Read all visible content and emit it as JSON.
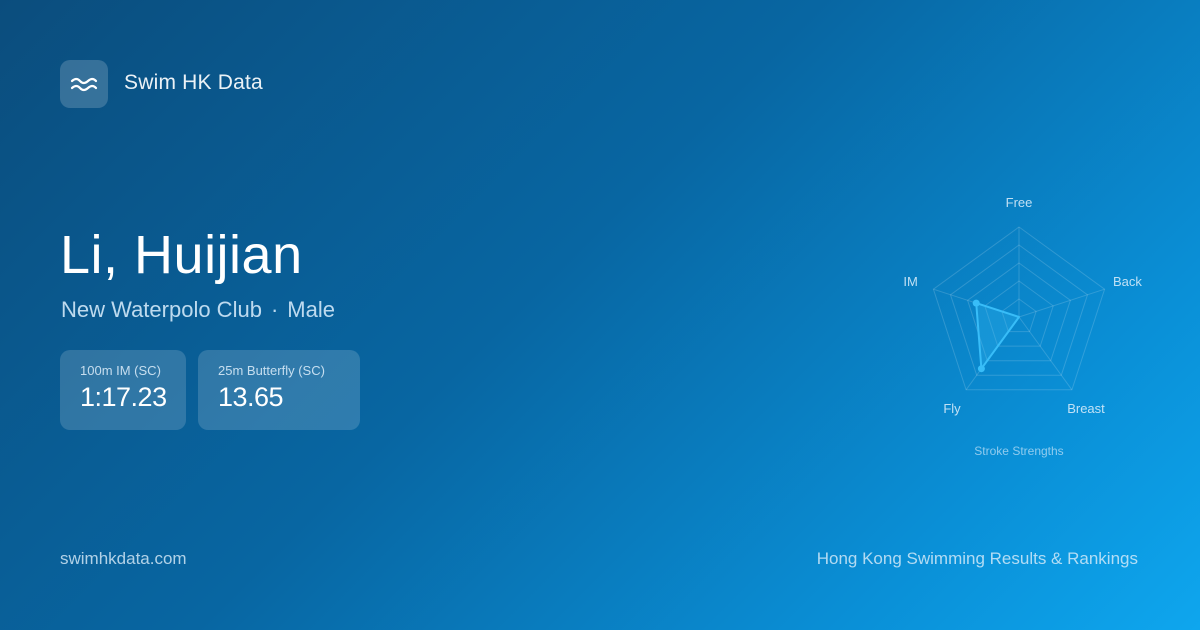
{
  "brand": {
    "name": "Swim HK Data",
    "logo_icon": "waves-icon"
  },
  "swimmer": {
    "name": "Li, Huijian",
    "club": "New Waterpolo Club",
    "separator": "·",
    "gender": "Male"
  },
  "best_times": [
    {
      "event": "100m IM (SC)",
      "time": "1:17.23"
    },
    {
      "event": "25m Butterfly (SC)",
      "time": "13.65"
    }
  ],
  "chart_data": {
    "type": "radar",
    "title": "Stroke Strengths",
    "axes": [
      "Free",
      "Back",
      "Breast",
      "Fly",
      "IM"
    ],
    "values": [
      0.0,
      0.0,
      0.0,
      0.71,
      0.5
    ],
    "rmax": 1,
    "rings": 5,
    "color": "#38bdf8"
  },
  "footer": {
    "site": "swimhkdata.com",
    "tagline": "Hong Kong Swimming Results & Rankings"
  }
}
